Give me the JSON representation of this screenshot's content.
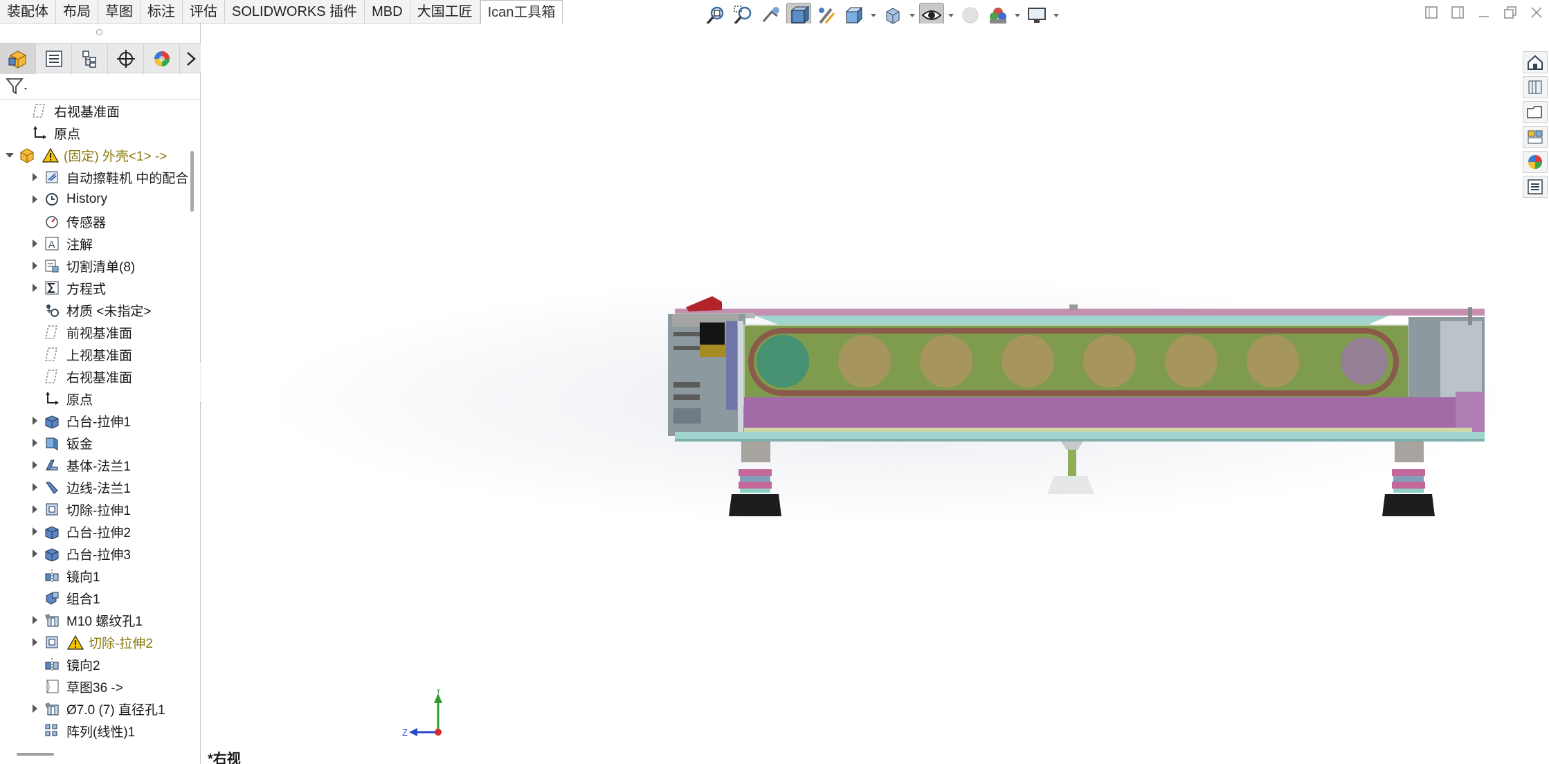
{
  "tabs": [
    {
      "label": "装配体"
    },
    {
      "label": "布局"
    },
    {
      "label": "草图"
    },
    {
      "label": "标注"
    },
    {
      "label": "评估"
    },
    {
      "label": "SOLIDWORKS 插件"
    },
    {
      "label": "MBD"
    },
    {
      "label": "大国工匠"
    },
    {
      "label": "Ican工具箱"
    }
  ],
  "active_tab": "Ican工具箱",
  "hud_icons": [
    "zoom-to-fit-icon",
    "zoom-to-area-icon",
    "previous-view-icon",
    "section-view-icon",
    "dynamic-annotation-icon",
    "view-orientation-icon",
    "display-style-icon",
    "hide-show-items-icon",
    "edit-appearance-icon",
    "apply-scene-icon",
    "view-settings-icon"
  ],
  "tree": {
    "rows": [
      {
        "label": "右视基准面",
        "icon": "plane-icon",
        "indent": 1,
        "expander": "none"
      },
      {
        "label": "原点",
        "icon": "origin-icon",
        "indent": 1,
        "expander": "none"
      },
      {
        "label": "(固定) 外壳<1> ->",
        "icon": "part-icon",
        "indent": 0,
        "expander": "open",
        "warning": true
      },
      {
        "label": "自动擦鞋机 中的配合",
        "icon": "mates-icon",
        "indent": 2,
        "expander": "closed"
      },
      {
        "label": "History",
        "icon": "history-icon",
        "indent": 2,
        "expander": "closed"
      },
      {
        "label": "传感器",
        "icon": "sensor-icon",
        "indent": 2,
        "expander": "none"
      },
      {
        "label": "注解",
        "icon": "annotation-icon",
        "indent": 2,
        "expander": "closed"
      },
      {
        "label": "切割清单(8)",
        "icon": "cut-list-icon",
        "indent": 2,
        "expander": "closed"
      },
      {
        "label": "方程式",
        "icon": "equation-icon",
        "indent": 2,
        "expander": "closed"
      },
      {
        "label": "材质 <未指定>",
        "icon": "material-icon",
        "indent": 2,
        "expander": "none"
      },
      {
        "label": "前视基准面",
        "icon": "plane-icon",
        "indent": 2,
        "expander": "none"
      },
      {
        "label": "上视基准面",
        "icon": "plane-icon",
        "indent": 2,
        "expander": "none"
      },
      {
        "label": "右视基准面",
        "icon": "plane-icon",
        "indent": 2,
        "expander": "none"
      },
      {
        "label": "原点",
        "icon": "origin-icon",
        "indent": 2,
        "expander": "none"
      },
      {
        "label": "凸台-拉伸1",
        "icon": "boss-extrude-icon",
        "indent": 2,
        "expander": "closed"
      },
      {
        "label": "钣金",
        "icon": "sheet-metal-icon",
        "indent": 2,
        "expander": "closed"
      },
      {
        "label": "基体-法兰1",
        "icon": "base-flange-icon",
        "indent": 2,
        "expander": "closed"
      },
      {
        "label": "边线-法兰1",
        "icon": "edge-flange-icon",
        "indent": 2,
        "expander": "closed"
      },
      {
        "label": "切除-拉伸1",
        "icon": "cut-extrude-icon",
        "indent": 2,
        "expander": "closed"
      },
      {
        "label": "凸台-拉伸2",
        "icon": "boss-extrude-icon",
        "indent": 2,
        "expander": "closed"
      },
      {
        "label": "凸台-拉伸3",
        "icon": "boss-extrude-icon",
        "indent": 2,
        "expander": "closed"
      },
      {
        "label": "镜向1",
        "icon": "mirror-icon",
        "indent": 2,
        "expander": "none"
      },
      {
        "label": "组合1",
        "icon": "combine-icon",
        "indent": 2,
        "expander": "none"
      },
      {
        "label": "M10 螺纹孔1",
        "icon": "hole-wizard-icon",
        "indent": 2,
        "expander": "closed"
      },
      {
        "label": "切除-拉伸2",
        "icon": "cut-extrude-icon",
        "indent": 2,
        "expander": "closed",
        "warning": true
      },
      {
        "label": "镜向2",
        "icon": "mirror-icon",
        "indent": 2,
        "expander": "none"
      },
      {
        "label": "草图36 ->",
        "icon": "sketch-icon",
        "indent": 2,
        "expander": "none"
      },
      {
        "label": "Ø7.0 (7) 直径孔1",
        "icon": "hole-wizard-icon",
        "indent": 2,
        "expander": "closed"
      },
      {
        "label": "阵列(线性)1",
        "icon": "linear-pattern-icon",
        "indent": 2,
        "expander": "none"
      }
    ]
  },
  "triad": {
    "y_label": "Y",
    "z_label": "Z"
  },
  "view_label": "*右视",
  "colors": {
    "panel_bg": "#ffffff",
    "tab_bg": "#f3f3f3",
    "warning": "#f5c400",
    "model_purple": "#a26aa6",
    "model_green": "#7f9b4e",
    "model_teal": "#8fd0c6"
  }
}
